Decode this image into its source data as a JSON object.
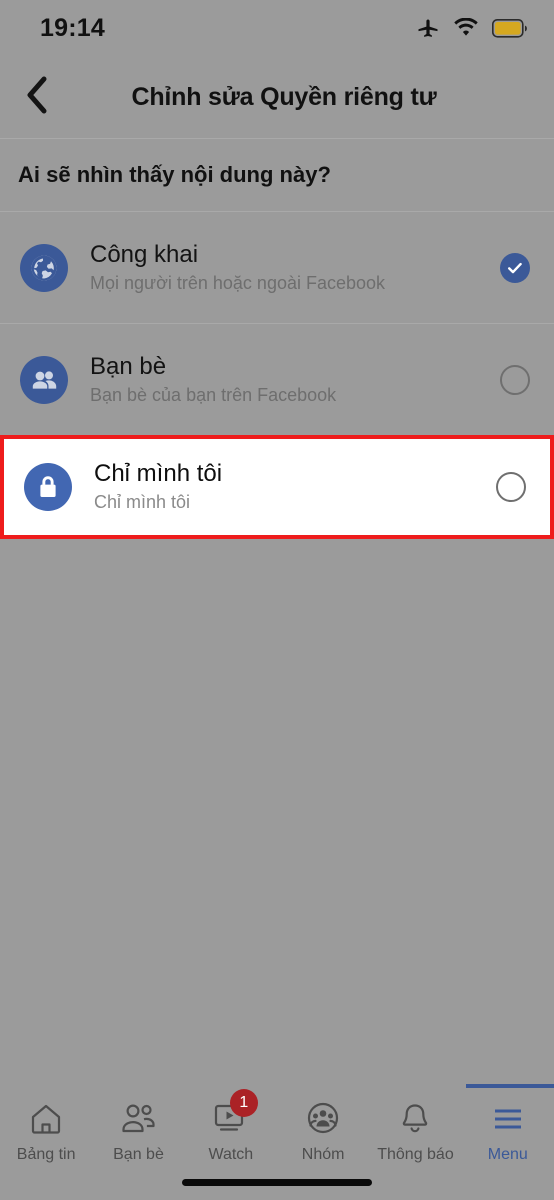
{
  "status_bar": {
    "time": "19:14",
    "icons": [
      "airplane-mode-icon",
      "wifi-icon",
      "battery-icon"
    ],
    "battery_color": "#d5a820"
  },
  "nav_bar": {
    "back_icon": "chevron-left-icon",
    "title": "Chỉnh sửa Quyền riêng tư"
  },
  "section": {
    "header": "Ai sẽ nhìn thấy nội dung này?"
  },
  "options": [
    {
      "icon": "globe-icon",
      "title": "Công khai",
      "subtitle": "Mọi người trên hoặc ngoài Facebook",
      "selected": true,
      "highlighted": false
    },
    {
      "icon": "friends-icon",
      "title": "Bạn bè",
      "subtitle": "Bạn bè của bạn trên Facebook",
      "selected": false,
      "highlighted": false
    },
    {
      "icon": "lock-icon",
      "title": "Chỉ mình tôi",
      "subtitle": "Chỉ mình tôi",
      "selected": false,
      "highlighted": true
    }
  ],
  "bottom_nav": {
    "tabs": [
      {
        "icon": "home-icon",
        "label": "Bảng tin",
        "badge": "",
        "active": false
      },
      {
        "icon": "friends-outline-icon",
        "label": "Bạn bè",
        "badge": "",
        "active": false
      },
      {
        "icon": "watch-icon",
        "label": "Watch",
        "badge": "1",
        "active": false
      },
      {
        "icon": "groups-icon",
        "label": "Nhóm",
        "badge": "",
        "active": false
      },
      {
        "icon": "bell-icon",
        "label": "Thông báo",
        "badge": "",
        "active": false
      },
      {
        "icon": "hamburger-menu-icon",
        "label": "Menu",
        "badge": "",
        "active": true
      }
    ]
  },
  "colors": {
    "background": "#9b9b9b",
    "facebook_blue": "#3b5998",
    "highlight_red": "#ee1c1c",
    "badge_red": "#ab2226",
    "white_row": "#ffffff"
  }
}
